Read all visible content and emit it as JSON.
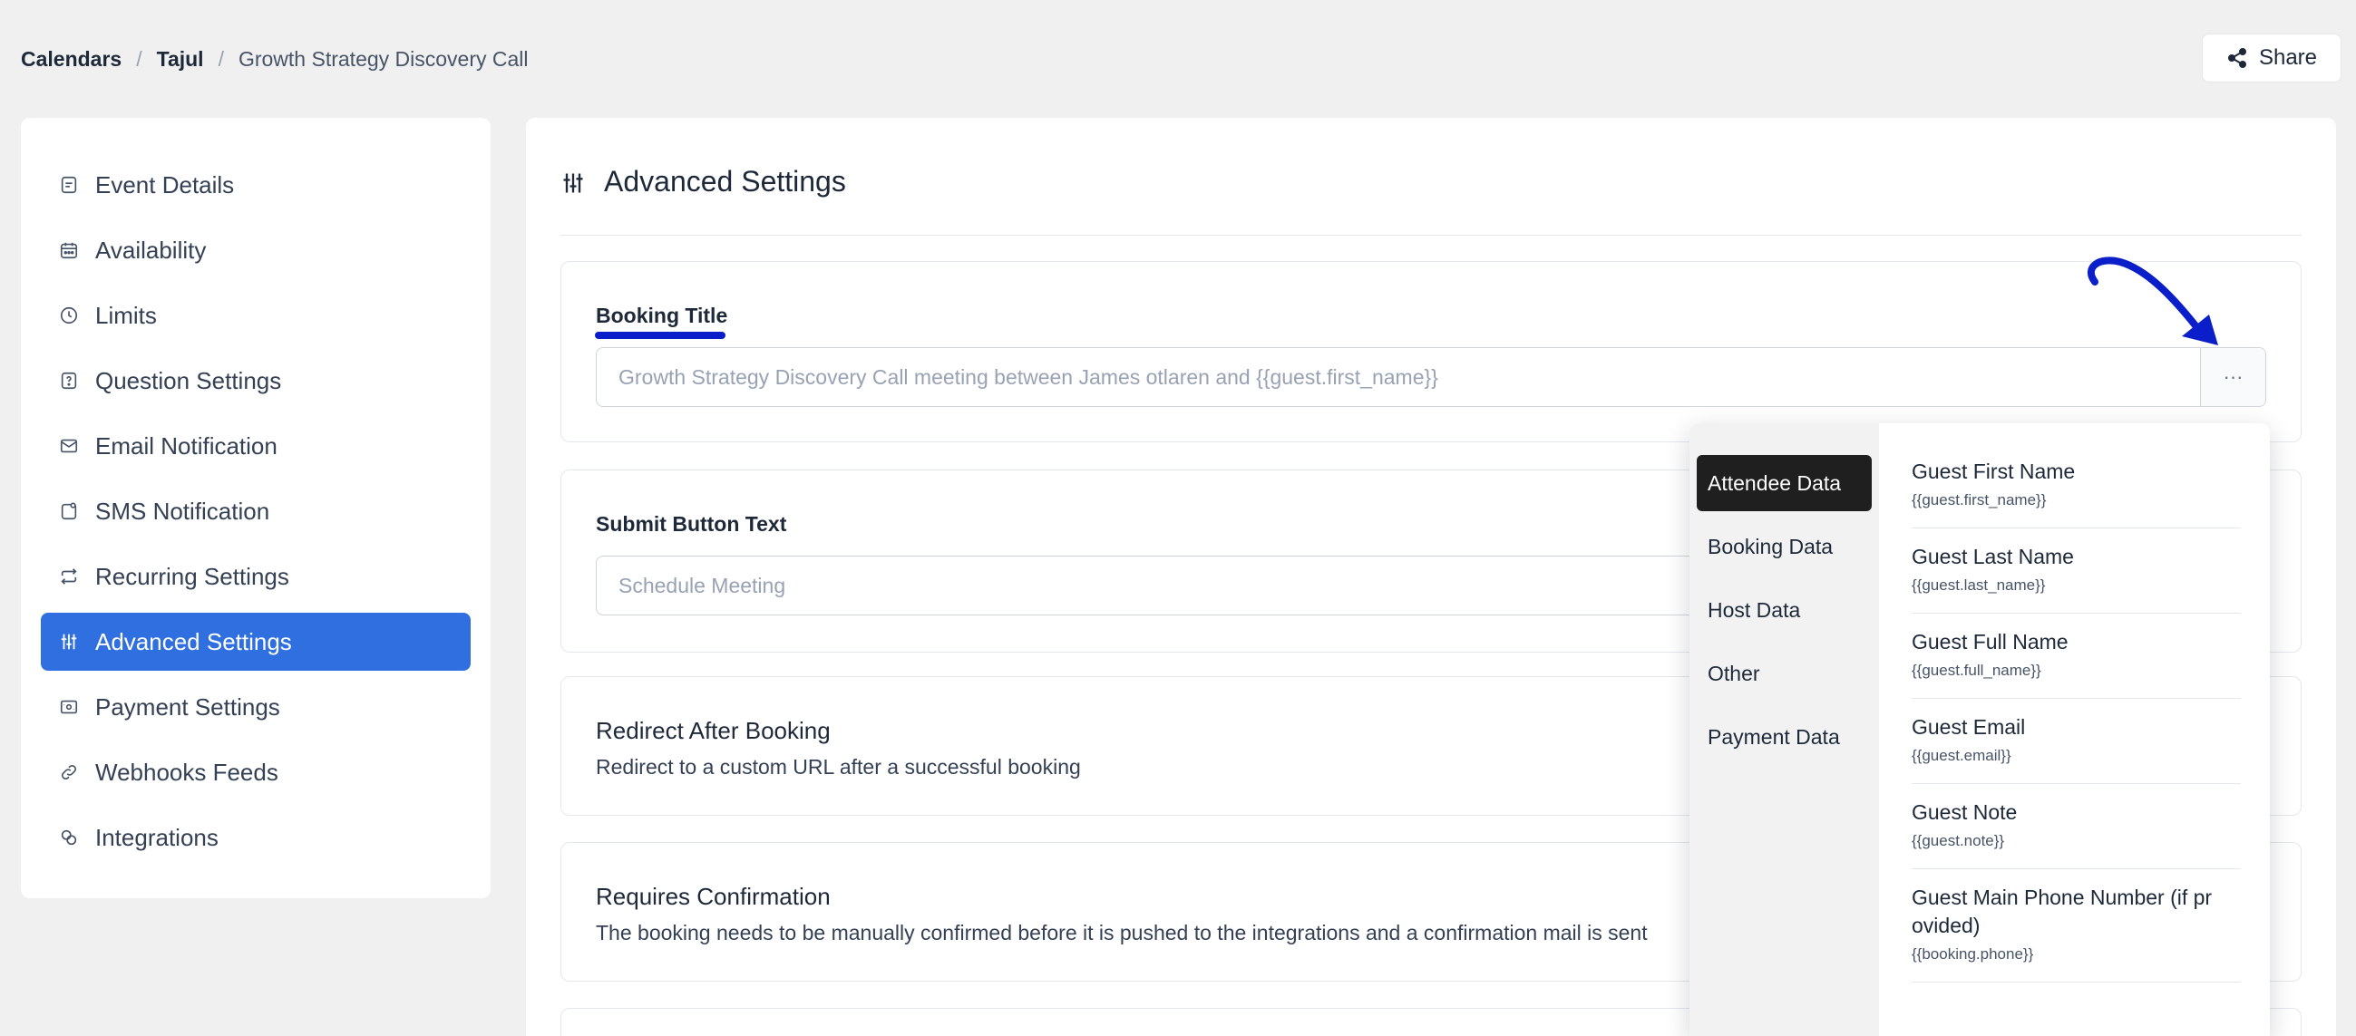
{
  "breadcrumb": {
    "calendars": "Calendars",
    "sep1": "/",
    "owner": "Tajul",
    "sep2": "/",
    "event": "Growth Strategy Discovery Call"
  },
  "share": {
    "label": "Share",
    "icon": "share-icon"
  },
  "sidebar": {
    "items": [
      {
        "label": "Event Details",
        "icon": "document-icon"
      },
      {
        "label": "Availability",
        "icon": "calendar-icon"
      },
      {
        "label": "Limits",
        "icon": "clock-icon"
      },
      {
        "label": "Question Settings",
        "icon": "question-icon"
      },
      {
        "label": "Email Notification",
        "icon": "mail-icon"
      },
      {
        "label": "SMS Notification",
        "icon": "sms-icon"
      },
      {
        "label": "Recurring Settings",
        "icon": "repeat-icon"
      },
      {
        "label": "Advanced Settings",
        "icon": "sliders-icon",
        "active": true
      },
      {
        "label": "Payment Settings",
        "icon": "payment-icon"
      },
      {
        "label": "Webhooks Feeds",
        "icon": "link-icon"
      },
      {
        "label": "Integrations",
        "icon": "integrations-icon"
      }
    ]
  },
  "main": {
    "title": "Advanced Settings",
    "booking_title": {
      "label": "Booking Title",
      "value": "Growth Strategy Discovery Call meeting between James otlaren and {{guest.first_name}}",
      "addon": "···"
    },
    "submit_button": {
      "label": "Submit Button Text",
      "placeholder": "Schedule Meeting"
    },
    "redirect": {
      "title": "Redirect After Booking",
      "description": "Redirect to a custom URL after a successful booking"
    },
    "confirmation": {
      "title": "Requires Confirmation",
      "description": "The booking needs to be manually confirmed before it is pushed to the integrations and a confirmation mail is sent"
    }
  },
  "dropdown": {
    "categories": [
      {
        "label": "Attendee Data",
        "active": true
      },
      {
        "label": "Booking Data"
      },
      {
        "label": "Host Data"
      },
      {
        "label": "Other"
      },
      {
        "label": "Payment Data"
      }
    ],
    "options": [
      {
        "label": "Guest First Name",
        "code": "{{guest.first_name}}"
      },
      {
        "label": "Guest Last Name",
        "code": "{{guest.last_name}}"
      },
      {
        "label": "Guest Full Name",
        "code": "{{guest.full_name}}"
      },
      {
        "label": "Guest Email",
        "code": "{{guest.email}}"
      },
      {
        "label": "Guest Note",
        "code": "{{guest.note}}"
      },
      {
        "label": "Guest Main Phone Number (if pr\novided)",
        "code": "{{booking.phone}}"
      }
    ]
  },
  "colors": {
    "accent": "#2f6fe0",
    "annotation": "#0a1fc9",
    "active_category": "#1f1f1f"
  }
}
